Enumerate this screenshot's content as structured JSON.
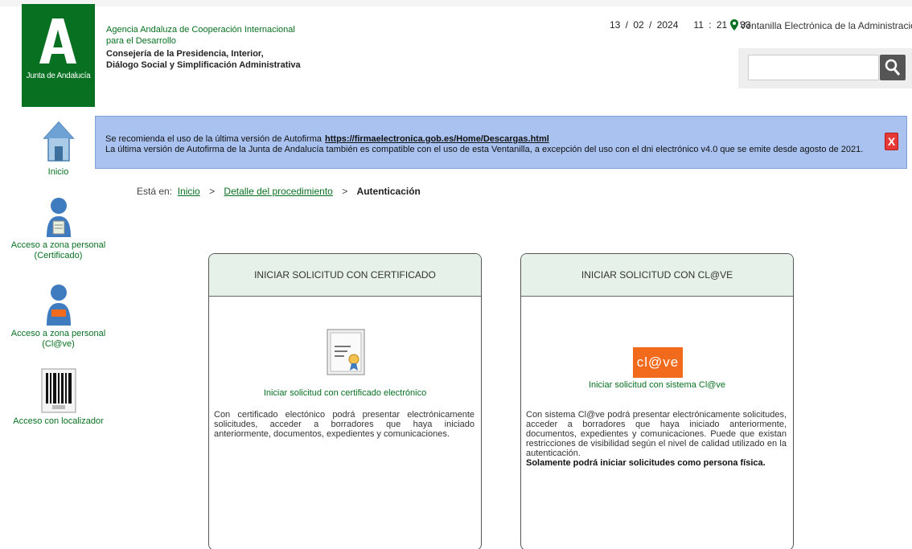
{
  "header": {
    "logo_text": "Junta de Andalucía",
    "agency_line1": "Agencia Andaluza de Cooperación Internacional",
    "agency_line2": "para el Desarrollo",
    "ministry_line1": "Consejería de la Presidencia, Interior,",
    "ministry_line2": "Diálogo Social y Simplificación Administrativa",
    "date": "13 / 02 / 2024",
    "time": "11 : 21 : 33",
    "ventanilla": "Ventanilla Electrónica de la Administración",
    "search_placeholder": "",
    "search_value": ""
  },
  "sidebar": {
    "items": [
      {
        "label": "Inicio",
        "icon": "house-icon"
      },
      {
        "label": "Acceso a zona personal (Certificado)",
        "icon": "user-certificate-icon"
      },
      {
        "label": "Acceso a zona personal (Cl@ve)",
        "icon": "user-clave-icon"
      },
      {
        "label": "Acceso con localizador",
        "icon": "barcode-icon"
      }
    ]
  },
  "banner": {
    "line1_text": "Se recomienda el uso de la última versión de Autofirma",
    "line1_link": "https://firmaelectronica.gob.es/Home/Descargas.html",
    "line2_text": "La última versión de Autofirma de la Junta de Andalucía también es compatible con el uso de esta Ventanilla, a excepción del uso con el dni electrónico v4.0 que se emite desde agosto de 2021.",
    "close_label": "X"
  },
  "breadcrumb": {
    "prefix": "Está en:",
    "items": [
      "Inicio",
      "Detalle del procedimiento"
    ],
    "current": "Autenticación",
    "separator": ">"
  },
  "cards": [
    {
      "title": "INICIAR SOLICITUD CON CERTIFICADO",
      "link": "Iniciar solicitud con certificado electrónico",
      "description": "Con certificado electónico podrá presentar electrónicamente solicitudes, acceder a borradores que haya iniciado anteriormente, documentos, expedientes y comunicaciones.",
      "note": ""
    },
    {
      "title": "INICIAR SOLICITUD CON CL@VE",
      "logo_text": "cl@ve",
      "link": "Iniciar solicitud con sistema Cl@ve",
      "description": "Con sistema Cl@ve podrá presentar electrónicamente solicitudes, acceder a borradores que haya iniciado anteriormente, documentos, expedientes y comunicaciones. Puede que existan restricciones de visibilidad según el nivel de calidad utilizado en la autenticación.",
      "note": "Solamente podrá iniciar solicitudes como persona física."
    }
  ],
  "colors": {
    "brand_green": "#087021",
    "banner_blue": "#a9c2ef",
    "card_head": "#e6f1e9",
    "clave_orange": "#f26a1b",
    "close_red": "#e53935"
  }
}
